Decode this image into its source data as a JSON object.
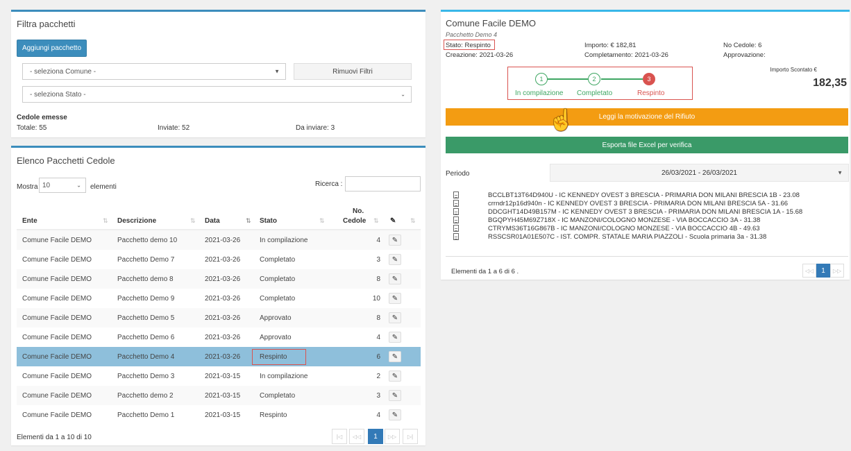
{
  "filter": {
    "title": "Filtra pacchetti",
    "add_button": "Aggiungi pacchetto",
    "comune_select": "- seleziona Comune -",
    "remove_filters": "Rimuovi Filtri",
    "stato_select": "- seleziona Stato -",
    "cedole_heading": "Cedole emesse",
    "totale": "Totale: 55",
    "inviate": "Inviate: 52",
    "da_inviare": "Da inviare: 3"
  },
  "list": {
    "title": "Elenco Pacchetti Cedole",
    "show_label": "Mostra",
    "page_size": "10",
    "elements_label": "elementi",
    "search_label": "Ricerca :",
    "search_value": "",
    "columns": [
      "Ente",
      "Descrizione",
      "Data",
      "Stato",
      "No.\nCedole"
    ],
    "col_ente": "Ente",
    "col_descr": "Descrizione",
    "col_data": "Data",
    "col_stato": "Stato",
    "col_no": "No.",
    "col_cedole": "Cedole",
    "rows": [
      {
        "ente": "Comune Facile DEMO",
        "descr": "Pacchetto demo 10",
        "data": "2021-03-26",
        "stato": "In compilazione",
        "n": "4"
      },
      {
        "ente": "Comune Facile DEMO",
        "descr": "Pacchetto Demo 7",
        "data": "2021-03-26",
        "stato": "Completato",
        "n": "3"
      },
      {
        "ente": "Comune Facile DEMO",
        "descr": "Pacchetto demo 8",
        "data": "2021-03-26",
        "stato": "Completato",
        "n": "8"
      },
      {
        "ente": "Comune Facile DEMO",
        "descr": "Pacchetto Demo 9",
        "data": "2021-03-26",
        "stato": "Completato",
        "n": "10"
      },
      {
        "ente": "Comune Facile DEMO",
        "descr": "Pacchetto Demo 5",
        "data": "2021-03-26",
        "stato": "Approvato",
        "n": "8"
      },
      {
        "ente": "Comune Facile DEMO",
        "descr": "Pacchetto Demo 6",
        "data": "2021-03-26",
        "stato": "Approvato",
        "n": "4"
      },
      {
        "ente": "Comune Facile DEMO",
        "descr": "Pacchetto Demo 4",
        "data": "2021-03-26",
        "stato": "Respinto",
        "n": "6"
      },
      {
        "ente": "Comune Facile DEMO",
        "descr": "Pacchetto Demo 3",
        "data": "2021-03-15",
        "stato": "In compilazione",
        "n": "2"
      },
      {
        "ente": "Comune Facile DEMO",
        "descr": "Pacchetto demo 2",
        "data": "2021-03-15",
        "stato": "Completato",
        "n": "3"
      },
      {
        "ente": "Comune Facile DEMO",
        "descr": "Pacchetto Demo 1",
        "data": "2021-03-15",
        "stato": "Respinto",
        "n": "4"
      }
    ],
    "footer": "Elementi da 1 a 10 di 10",
    "current_page": "1"
  },
  "detail": {
    "title": "Comune Facile DEMO",
    "subtitle": "Pacchetto Demo 4",
    "stato": "Stato: Respinto",
    "creazione": "Creazione: 2021-03-26",
    "importo": "Importo: € 182,81",
    "completamento": "Completamento: 2021-03-26",
    "no_cedole": "No Cedole: 6",
    "approvazione": "Approvazione:",
    "steps": [
      {
        "num": "1",
        "label": "In compilazione"
      },
      {
        "num": "2",
        "label": "Completato"
      },
      {
        "num": "3",
        "label": "Respinto"
      }
    ],
    "importo_scontato_label": "Importo Scontato €",
    "importo_scontato": "182,35",
    "motivazione_button": "Leggi la motivazione del Rifiuto",
    "export_button": "Esporta file Excel per verifica",
    "periodo_label": "Periodo",
    "periodo_value": "26/03/2021 - 26/03/2021",
    "documents": [
      "BCCLBT13T64D940U - IC KENNEDY OVEST 3 BRESCIA - PRIMARIA DON MILANI BRESCIA 1B - 23.08",
      "crrndr12p16d940n - IC KENNEDY OVEST 3 BRESCIA - PRIMARIA DON MILANI BRESCIA 5A - 31.66",
      "DDCGHT14D49B157M - IC KENNEDY OVEST 3 BRESCIA - PRIMARIA DON MILANI BRESCIA 1A - 15.68",
      "BGQPYH45M69Z718X - IC MANZONI/COLOGNO MONZESE - VIA BOCCACCIO 3A - 31.38",
      "CTRYMS36T16G867B - IC MANZONI/COLOGNO MONZESE - VIA BOCCACCIO 4B - 49.63",
      "RSSCSR01A01E507C - IST. COMPR. STATALE MARIA PIAZZOLI - Scuola primaria 3a - 31.38"
    ],
    "footer": "Elementi da 1 a 6 di 6 .",
    "current_page": "1"
  },
  "colors": {
    "primary": "#3c8dbc",
    "green": "#3ea662",
    "orange": "#f39c12",
    "export_green": "#3a9a68",
    "red": "#d9534f"
  }
}
